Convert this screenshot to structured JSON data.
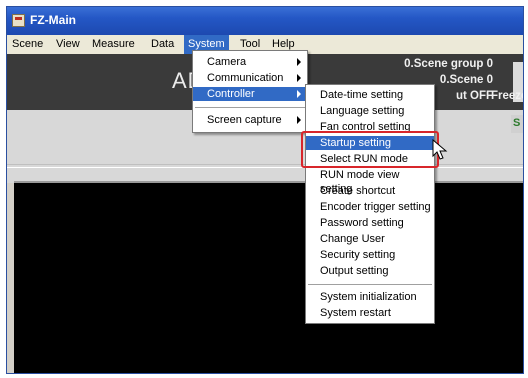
{
  "window": {
    "title": "FZ-Main"
  },
  "menubar": [
    "Scene",
    "View",
    "Measure",
    "Data",
    "System",
    "Tool",
    "Help"
  ],
  "status": {
    "big_text": "AD",
    "scene_group": "0.Scene group 0",
    "scene": "0.Scene 0",
    "output": "ut OFF",
    "freeze": "Freeze",
    "side_letter": "S"
  },
  "system_menu": {
    "items": [
      "Camera",
      "Communication",
      "Controller",
      "Screen capture"
    ],
    "highlighted": "Controller"
  },
  "controller_menu": {
    "items": [
      "Date-time setting",
      "Language setting",
      "Fan control setting",
      "Startup setting",
      "Select RUN mode",
      "RUN mode view setting",
      "Create shortcut",
      "Encoder trigger setting",
      "Password setting",
      "Change User",
      "Security setting",
      "Output setting",
      "System initialization",
      "System restart"
    ],
    "highlighted": "Startup setting",
    "callout_items": [
      "Startup setting",
      "Select RUN mode"
    ]
  },
  "colors": {
    "highlight": "#316ac5",
    "callout": "#d8262b",
    "titlebar": "#2457c5"
  }
}
